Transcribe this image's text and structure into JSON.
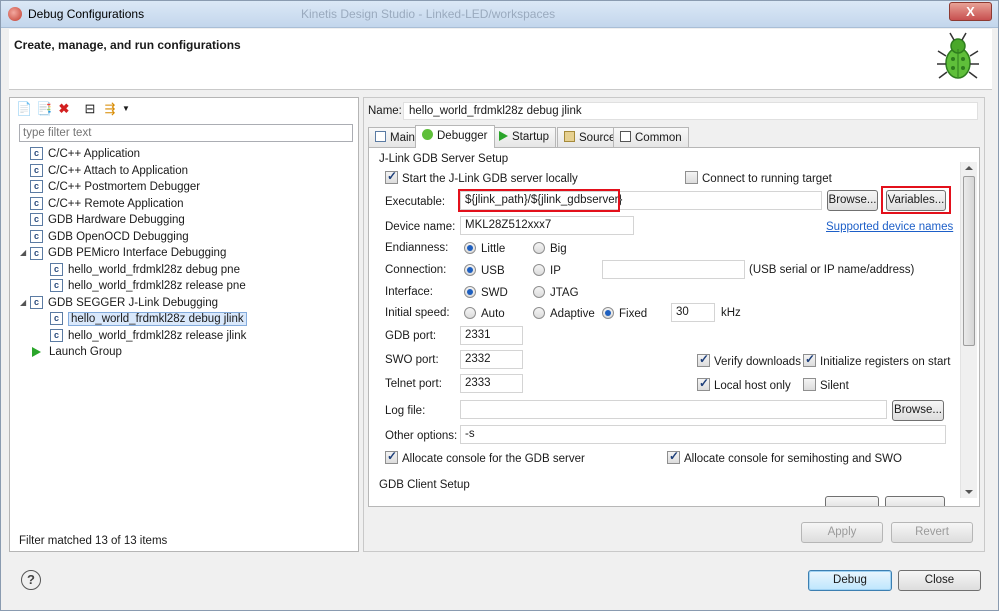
{
  "window": {
    "title": "Debug Configurations",
    "background_title": "Kinetis Design Studio - Linked-LED/workspaces",
    "close_label": "X"
  },
  "header": {
    "heading": "Create, manage, and run configurations"
  },
  "left": {
    "filter_placeholder": "type filter text",
    "tree": [
      {
        "label": "C/C++ Application",
        "level": 0
      },
      {
        "label": "C/C++ Attach to Application",
        "level": 0
      },
      {
        "label": "C/C++ Postmortem Debugger",
        "level": 0
      },
      {
        "label": "C/C++ Remote Application",
        "level": 0
      },
      {
        "label": "GDB Hardware Debugging",
        "level": 0
      },
      {
        "label": "GDB OpenOCD Debugging",
        "level": 0
      },
      {
        "label": "GDB PEMicro Interface Debugging",
        "level": 0
      },
      {
        "label": "hello_world_frdmkl28z debug pne",
        "level": 1
      },
      {
        "label": "hello_world_frdmkl28z release pne",
        "level": 1
      },
      {
        "label": "GDB SEGGER J-Link Debugging",
        "level": 0
      },
      {
        "label": "hello_world_frdmkl28z debug jlink",
        "level": 1
      },
      {
        "label": "hello_world_frdmkl28z release jlink",
        "level": 1
      },
      {
        "label": "Launch Group",
        "level": 0
      }
    ],
    "status": "Filter matched 13 of 13 items"
  },
  "right": {
    "name_label": "Name:",
    "name_value": "hello_world_frdmkl28z debug jlink",
    "tabs": [
      "Main",
      "Debugger",
      "Startup",
      "Source",
      "Common"
    ],
    "server_group": "J-Link GDB Server Setup",
    "start_locally": "Start the J-Link GDB server locally",
    "connect_running": "Connect to running target",
    "executable_label": "Executable:",
    "executable_value": "${jlink_path}/${jlink_gdbserver}",
    "browse_label": "Browse...",
    "variables_label": "Variables...",
    "device_label": "Device name:",
    "device_value": "MKL28Z512xxx7",
    "supported_devices": "Supported device names",
    "endianness_label": "Endianness:",
    "little": "Little",
    "big": "Big",
    "connection_label": "Connection:",
    "usb": "USB",
    "ip": "IP",
    "ip_hint": "(USB serial or IP name/address)",
    "interface_label": "Interface:",
    "swd": "SWD",
    "jtag": "JTAG",
    "speed_label": "Initial speed:",
    "auto": "Auto",
    "adaptive": "Adaptive",
    "fixed": "Fixed",
    "speed_value": "30",
    "khz": "kHz",
    "gdb_port_label": "GDB port:",
    "gdb_port": "2331",
    "swo_port_label": "SWO port:",
    "swo_port": "2332",
    "telnet_port_label": "Telnet port:",
    "telnet_port": "2333",
    "verify_downloads": "Verify downloads",
    "init_registers": "Initialize registers on start",
    "local_host_only": "Local host only",
    "silent": "Silent",
    "log_label": "Log file:",
    "log_value": "",
    "other_label": "Other options:",
    "other_value": "-s",
    "alloc_gdb": "Allocate console for the GDB server",
    "alloc_semi": "Allocate console for semihosting and SWO",
    "client_group": "GDB Client Setup",
    "apply": "Apply",
    "revert": "Revert"
  },
  "footer": {
    "help": "?",
    "debug": "Debug",
    "close": "Close"
  },
  "colors": {
    "highlight": "#e3101b",
    "link": "#1d5fc8",
    "selection": "#d9e8fb"
  }
}
